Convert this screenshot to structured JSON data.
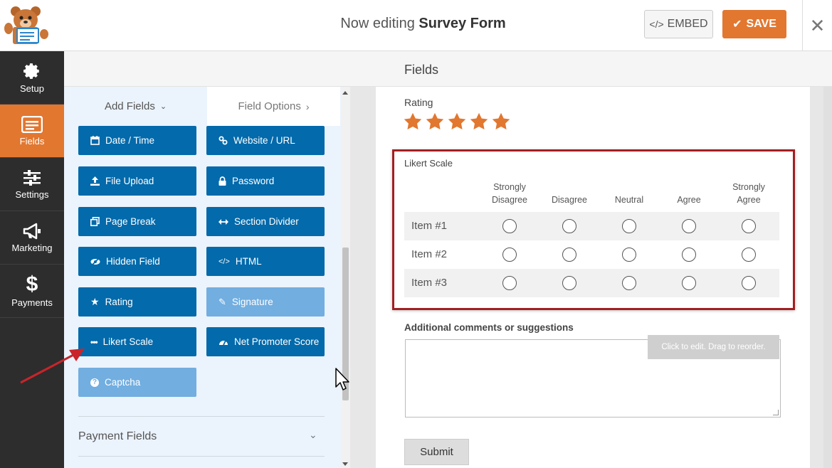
{
  "header": {
    "title_prefix": "Now editing",
    "form_name": "Survey Form",
    "embed_label": "EMBED",
    "save_label": "SAVE",
    "close_glyph": "✕"
  },
  "nav": [
    {
      "label": "Setup",
      "icon": "gear-icon"
    },
    {
      "label": "Fields",
      "icon": "fields-icon",
      "active": true
    },
    {
      "label": "Settings",
      "icon": "sliders-icon"
    },
    {
      "label": "Marketing",
      "icon": "megaphone-icon"
    },
    {
      "label": "Payments",
      "icon": "dollar-icon"
    }
  ],
  "section_title": "Fields",
  "panel": {
    "tab_add": "Add Fields",
    "tab_options": "Field Options",
    "buttons": [
      {
        "label": "Date / Time",
        "icon": "calendar-icon"
      },
      {
        "label": "Website / URL",
        "icon": "link-icon"
      },
      {
        "label": "File Upload",
        "icon": "upload-icon"
      },
      {
        "label": "Password",
        "icon": "lock-icon"
      },
      {
        "label": "Page Break",
        "icon": "copy-icon"
      },
      {
        "label": "Section Divider",
        "icon": "arrows-h-icon"
      },
      {
        "label": "Hidden Field",
        "icon": "eye-slash-icon"
      },
      {
        "label": "HTML",
        "icon": "code-icon"
      },
      {
        "label": "Rating",
        "icon": "star-icon"
      },
      {
        "label": "Signature",
        "icon": "pencil-icon"
      },
      {
        "label": "Likert Scale",
        "icon": "ellipsis-icon"
      },
      {
        "label": "Net Promoter Score",
        "icon": "gauge-icon"
      },
      {
        "label": "Captcha",
        "icon": "question-circle-icon"
      }
    ],
    "payment_fields": "Payment Fields"
  },
  "preview": {
    "rating_label": "Rating",
    "rating_stars": 5,
    "likert_label": "Likert Scale",
    "likert_columns": [
      [
        "Strongly",
        "Disagree"
      ],
      [
        "",
        "Disagree"
      ],
      [
        "",
        "Neutral"
      ],
      [
        "",
        "Agree"
      ],
      [
        "Strongly",
        "Agree"
      ]
    ],
    "likert_rows": [
      "Item #1",
      "Item #2",
      "Item #3"
    ],
    "comments_label": "Additional comments or suggestions",
    "tooltip": "Click to edit. Drag to reorder.",
    "submit_label": "Submit"
  },
  "colors": {
    "accent": "#e27730",
    "field_button": "#036aab",
    "field_button_light": "#72aee0",
    "highlight_border": "#a31f22"
  }
}
